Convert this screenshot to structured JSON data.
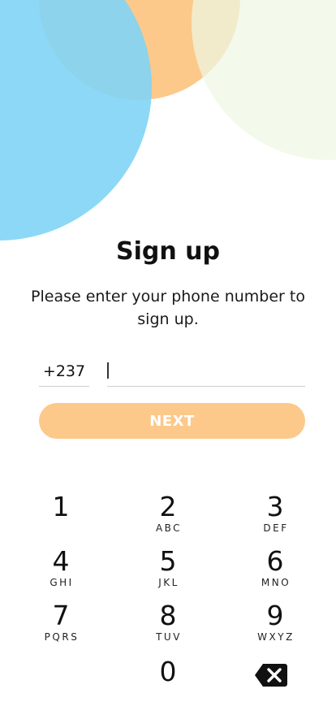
{
  "header": {
    "title": "Sign up",
    "subtitle": "Please enter your phone number to sign up."
  },
  "phone": {
    "country_code": "+237",
    "value": "",
    "placeholder": ""
  },
  "actions": {
    "next_label": "NEXT"
  },
  "keypad": {
    "keys": [
      {
        "digit": "1",
        "letters": ""
      },
      {
        "digit": "2",
        "letters": "ABC"
      },
      {
        "digit": "3",
        "letters": "DEF"
      },
      {
        "digit": "4",
        "letters": "GHI"
      },
      {
        "digit": "5",
        "letters": "JKL"
      },
      {
        "digit": "6",
        "letters": "MNO"
      },
      {
        "digit": "7",
        "letters": "PQRS"
      },
      {
        "digit": "8",
        "letters": "TUV"
      },
      {
        "digit": "9",
        "letters": "WXYZ"
      },
      {
        "digit": "0",
        "letters": ""
      }
    ],
    "backspace_icon": "backspace-icon"
  },
  "colors": {
    "accent": "#fcc98a",
    "blob_blue": "#7fd4f5",
    "blob_mint": "#eef8e4",
    "text": "#111111"
  }
}
